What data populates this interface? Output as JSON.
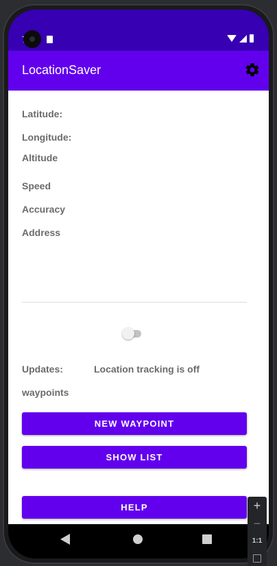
{
  "status_bar": {
    "time": "7",
    "icons": [
      "camera-icon",
      "sd-card-icon",
      "wifi-icon",
      "signal-icon",
      "battery-icon"
    ]
  },
  "app_bar": {
    "title": "LocationSaver",
    "settings_icon": "gear-icon"
  },
  "fields": {
    "latitude": "Latitude:",
    "longitude": "Longitude:",
    "altitude": "Altitude",
    "speed": "Speed",
    "accuracy": "Accuracy",
    "address": "Address"
  },
  "tracking": {
    "switch_on": false,
    "updates_label": "Updates:",
    "updates_value": "Location tracking is off",
    "waypoints_label": "waypoints"
  },
  "buttons": {
    "new_waypoint": "NEW WAYPOINT",
    "show_list": "SHOW LIST",
    "help": "HELP"
  },
  "nav": {
    "icons": [
      "back-icon",
      "home-icon",
      "recents-icon"
    ]
  },
  "emulator_zoom": {
    "zoom_in": "+",
    "zoom_out": "−",
    "ratio": "1:1"
  },
  "colors": {
    "status_bar": "#3700b3",
    "primary": "#6200ee",
    "label_text": "#6b6b6b"
  }
}
